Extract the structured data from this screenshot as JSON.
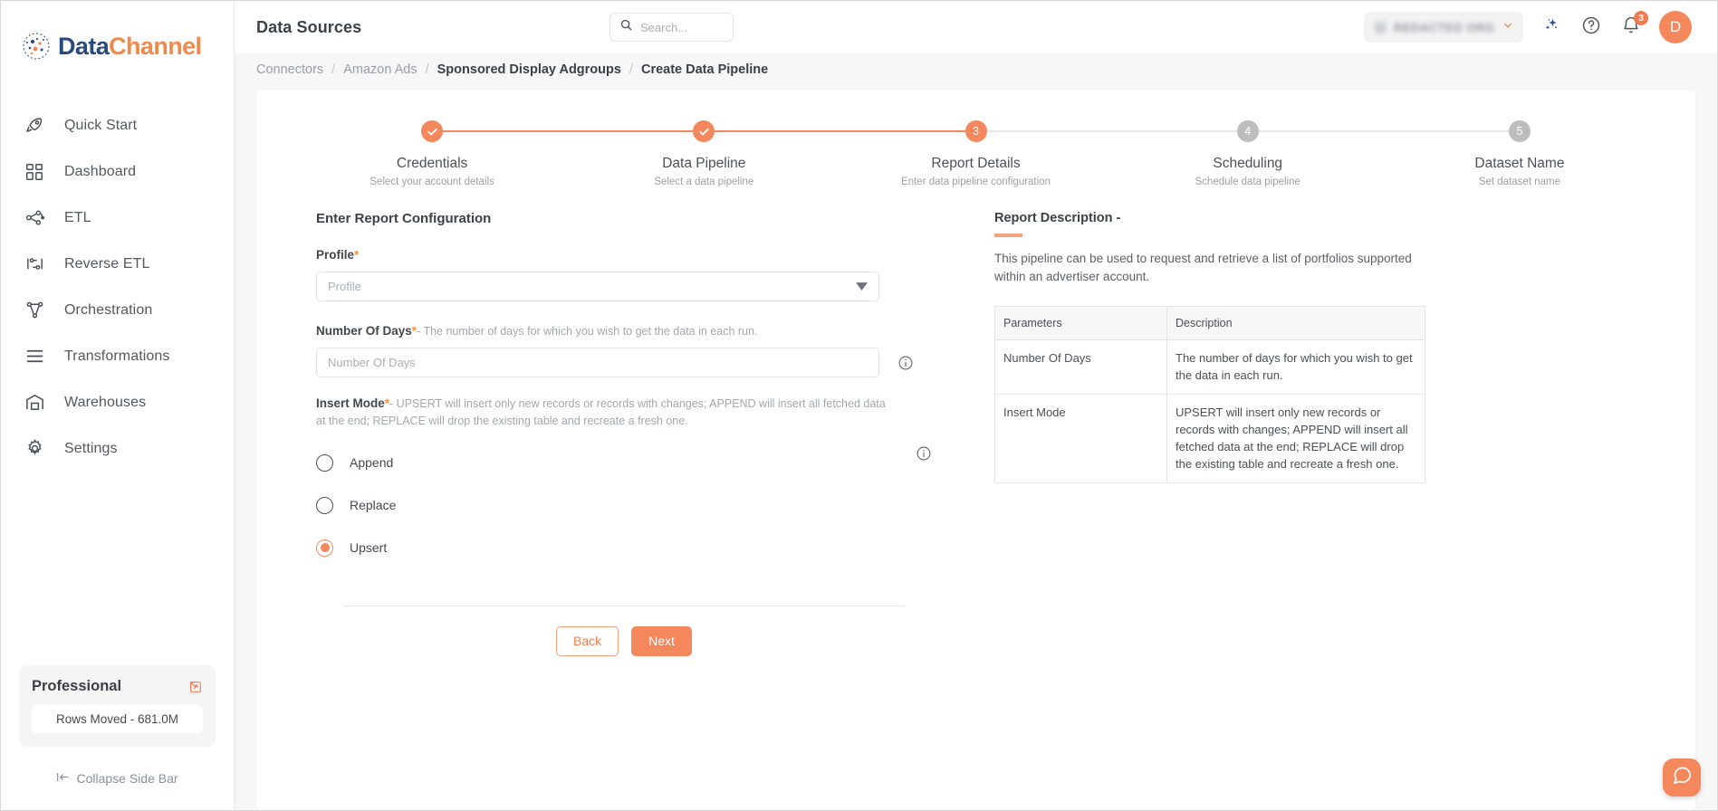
{
  "brand": {
    "part1": "Data",
    "part2": "Channel",
    "logo_icon": "datachannel-logo-icon"
  },
  "sidebar": {
    "items": [
      {
        "label": "Quick Start",
        "icon": "rocket-icon"
      },
      {
        "label": "Dashboard",
        "icon": "grid-icon"
      },
      {
        "label": "ETL",
        "icon": "etl-nodes-icon"
      },
      {
        "label": "Reverse ETL",
        "icon": "reverse-etl-icon"
      },
      {
        "label": "Orchestration",
        "icon": "orchestration-icon"
      },
      {
        "label": "Transformations",
        "icon": "transformations-icon"
      },
      {
        "label": "Warehouses",
        "icon": "warehouse-icon"
      },
      {
        "label": "Settings",
        "icon": "gear-icon"
      }
    ],
    "plan": {
      "name": "Professional",
      "external_icon": "external-link-icon",
      "rows_moved": "Rows Moved - 681.0M"
    },
    "collapse_label": "Collapse Side Bar"
  },
  "topbar": {
    "title": "Data Sources",
    "search_placeholder": "Search...",
    "search_value": "",
    "search_icon": "search-icon",
    "org_name": "REDACTED ORG",
    "ai_icon": "sparkle-ai-icon",
    "help_icon": "help-circle-icon",
    "notifications_icon": "bell-icon",
    "notifications_count": "3",
    "avatar_initial": "D"
  },
  "breadcrumb": [
    {
      "label": "Connectors",
      "active": false
    },
    {
      "label": "Amazon Ads",
      "active": false
    },
    {
      "label": "Sponsored Display Adgroups",
      "active": true
    },
    {
      "label": "Create Data Pipeline",
      "active": true
    }
  ],
  "stepper": {
    "steps": [
      {
        "num": "1",
        "state": "done",
        "title": "Credentials",
        "subtitle": "Select your account details"
      },
      {
        "num": "2",
        "state": "done",
        "title": "Data Pipeline",
        "subtitle": "Select a data pipeline"
      },
      {
        "num": "3",
        "state": "current",
        "title": "Report Details",
        "subtitle": "Enter data pipeline configuration"
      },
      {
        "num": "4",
        "state": "todo",
        "title": "Scheduling",
        "subtitle": "Schedule data pipeline"
      },
      {
        "num": "5",
        "state": "todo",
        "title": "Dataset Name",
        "subtitle": "Set dataset name"
      }
    ]
  },
  "form": {
    "section_title": "Enter Report Configuration",
    "profile": {
      "label": "Profile",
      "required": "*",
      "placeholder": "Profile",
      "value": "",
      "dropdown_icon": "chevron-down-icon"
    },
    "number_of_days": {
      "label": "Number Of Days",
      "required": "*",
      "hint": "- The number of days for which you wish to get the data in each run.",
      "placeholder": "Number Of Days",
      "value": "",
      "info_icon": "info-circle-icon"
    },
    "insert_mode": {
      "label": "Insert Mode",
      "required": "*",
      "hint": "- UPSERT will insert only new records or records with changes; APPEND will insert all fetched data at the end; REPLACE will drop the existing table and recreate a fresh one.",
      "info_icon": "info-circle-icon",
      "options": [
        {
          "label": "Append",
          "selected": false
        },
        {
          "label": "Replace",
          "selected": false
        },
        {
          "label": "Upsert",
          "selected": true
        }
      ]
    },
    "buttons": {
      "back": "Back",
      "next": "Next"
    }
  },
  "report_description": {
    "title": "Report Description -",
    "body": "This pipeline can be used to request and retrieve a list of portfolios supported within an advertiser account.",
    "table": {
      "headers": [
        "Parameters",
        "Description"
      ],
      "rows": [
        {
          "parameter": "Number Of Days",
          "description": "The number of days for which you wish to get the data in each run."
        },
        {
          "parameter": "Insert Mode",
          "description": "UPSERT will insert only new records or records with changes; APPEND will insert all fetched data at the end; REPLACE will drop the existing table and recreate a fresh one."
        }
      ]
    }
  },
  "chat": {
    "icon": "chat-bubble-icon"
  },
  "colors": {
    "accent": "#f4875b",
    "brand_blue": "#2a4a7c",
    "muted": "#9ca0a7",
    "panel_bg": "#f7f7f8"
  }
}
